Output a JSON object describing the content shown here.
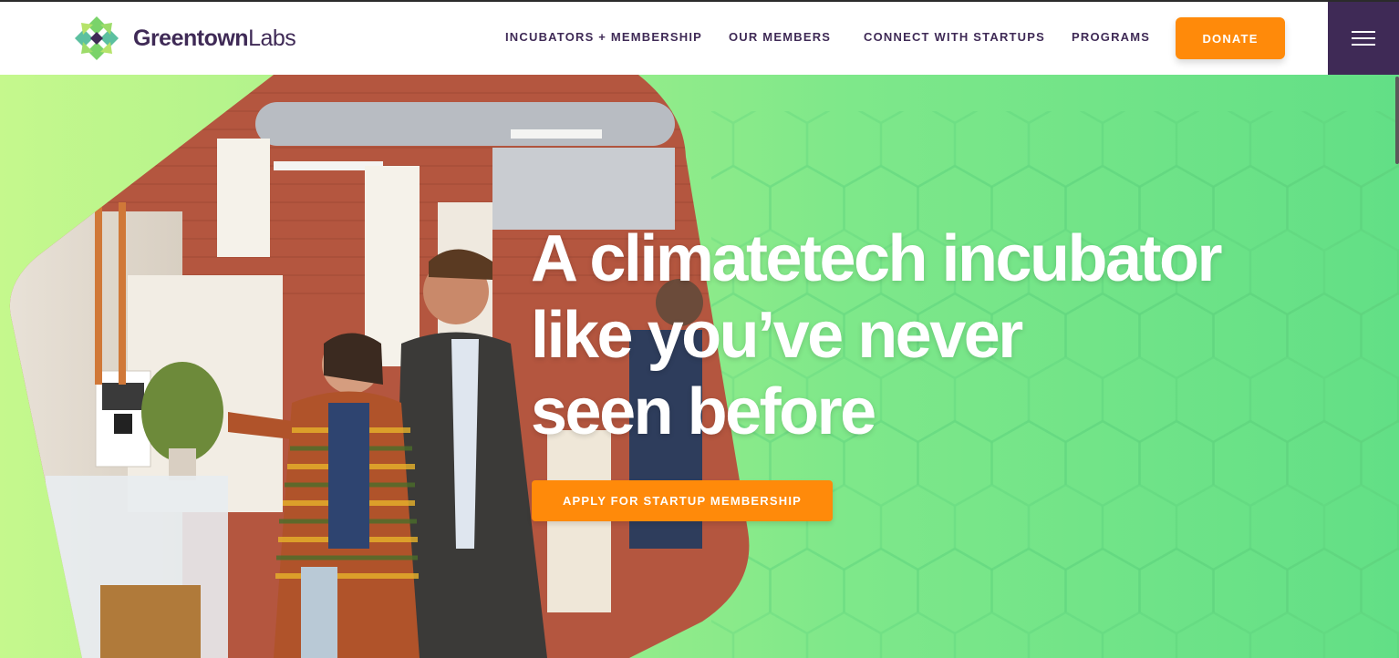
{
  "brand": {
    "name_strong": "Greentown",
    "name_light": "Labs",
    "colors": {
      "purple": "#3f2a56",
      "orange": "#ff8a0a",
      "green": "#7fe88a",
      "lime": "#c5f88d"
    }
  },
  "nav": {
    "items": [
      {
        "label": "INCUBATORS + MEMBERSHIP"
      },
      {
        "label": "OUR MEMBERS"
      },
      {
        "label": "CONNECT WITH STARTUPS"
      },
      {
        "label": "PROGRAMS"
      }
    ],
    "donate_label": "DONATE",
    "menu_icon": "hamburger-icon"
  },
  "hero": {
    "headline_lines": [
      "A climatetech incubator",
      "like you’ve never",
      "seen before"
    ],
    "cta_label": "APPLY FOR STARTUP MEMBERSHIP",
    "photo_alt_icon": "hero-photo"
  }
}
